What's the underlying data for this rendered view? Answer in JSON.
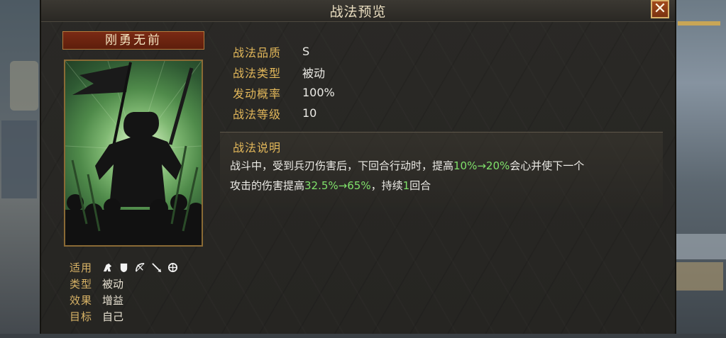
{
  "window": {
    "title": "战法预览",
    "close_label": "✕"
  },
  "skill": {
    "name": "刚勇无前",
    "stats": [
      {
        "key": "战法品质",
        "value": "S"
      },
      {
        "key": "战法类型",
        "value": "被动"
      },
      {
        "key": "发动概率",
        "value": "100%"
      },
      {
        "key": "战法等级",
        "value": "10"
      }
    ],
    "description": {
      "title": "战法说明",
      "line1_a": "战斗中，受到兵刃伤害后，下回合行动时，提高",
      "line1_hl": "10%→20%",
      "line1_b": "会心并使下一个",
      "line2_a": "攻击的伤害提高",
      "line2_hl": "32.5%→65%",
      "line2_b": "，持续",
      "line2_hl2": "1",
      "line2_c": "回合"
    },
    "attributes": {
      "applicable_label": "适用",
      "applicable_icons": [
        "cavalry-icon",
        "shield-icon",
        "bow-icon",
        "spear-icon",
        "wheel-icon"
      ],
      "type_label": "类型",
      "type_value": "被动",
      "effect_label": "效果",
      "effect_value": "增益",
      "target_label": "目标",
      "target_value": "自己"
    }
  },
  "colors": {
    "accent_gold": "#e2b75a",
    "highlight_green": "#7fe06a",
    "name_plate": "#7a2a14"
  }
}
